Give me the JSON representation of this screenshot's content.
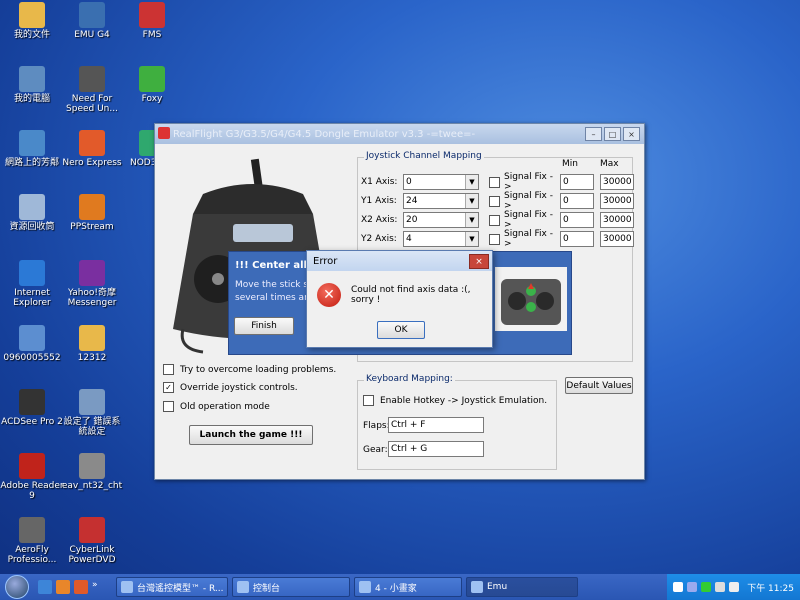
{
  "desktop_icons": [
    {
      "label": "我的文件",
      "icon": "folder-icon",
      "color": "#e8b84a"
    },
    {
      "label": "EMU G4",
      "icon": "app-shortcut-icon",
      "color": "#3a6fb0"
    },
    {
      "label": "FMS",
      "icon": "airplane-icon",
      "color": "#cc3333"
    },
    {
      "label": "我的電腦",
      "icon": "computer-icon",
      "color": "#5e8cc0"
    },
    {
      "label": "Need For Speed Un...",
      "icon": "game-icon",
      "color": "#555555"
    },
    {
      "label": "Foxy",
      "icon": "foxy-icon",
      "color": "#3faf3f"
    },
    {
      "label": "網路上的芳鄰",
      "icon": "network-icon",
      "color": "#4a89c9"
    },
    {
      "label": "Nero Express",
      "icon": "nero-icon",
      "color": "#e25a2a"
    },
    {
      "label": "NOD32-...",
      "icon": "nod32-icon",
      "color": "#2fa86e"
    },
    {
      "label": "資源回收筒",
      "icon": "recycle-bin-icon",
      "color": "#9fb8d8"
    },
    {
      "label": "PPStream",
      "icon": "ppstream-icon",
      "color": "#e07a1f"
    },
    {
      "label": "Internet Explorer",
      "icon": "ie-icon",
      "color": "#2b79d6"
    },
    {
      "label": "Yahoo!奇摩 Messenger",
      "icon": "yahoo-icon",
      "color": "#7a2fa0"
    },
    {
      "label": "0960005552",
      "icon": "shortcut-icon",
      "color": "#5c8ed0"
    },
    {
      "label": "12312",
      "icon": "folder-icon",
      "color": "#e8b84a"
    },
    {
      "label": "ACDSee Pro 2",
      "icon": "acdsee-icon",
      "color": "#333333"
    },
    {
      "label": "設定了 錯誤系統設定",
      "icon": "settings-icon",
      "color": "#7a9ac2"
    },
    {
      "label": "Adobe Reader 9",
      "icon": "adobe-reader-icon",
      "color": "#c0231b"
    },
    {
      "label": "eav_nt32_cht",
      "icon": "installer-icon",
      "color": "#8a8a8a"
    },
    {
      "label": "AeroFly Professio...",
      "icon": "aerofly-icon",
      "color": "#666666"
    },
    {
      "label": "CyberLink PowerDVD",
      "icon": "powerdvd-icon",
      "color": "#c53030"
    }
  ],
  "main_window": {
    "title": "RealFlight G3/G3.5/G4/G4.5 Dongle Emulator v3.3 -=twee=-",
    "controls": {
      "minimize": "–",
      "maximize": "□",
      "close": "×"
    },
    "joystick_group_title": "Joystick Channel Mapping",
    "col_min": "Min",
    "col_max": "Max",
    "signal_fix_label": "Signal Fix ->",
    "axes": [
      {
        "label": "X1 Axis:",
        "value": "0",
        "min": "0",
        "max": "30000"
      },
      {
        "label": "Y1 Axis:",
        "value": "24",
        "min": "0",
        "max": "30000"
      },
      {
        "label": "X2 Axis:",
        "value": "20",
        "min": "0",
        "max": "30000"
      },
      {
        "label": "Y2 Axis:",
        "value": "4",
        "min": "0",
        "max": "30000"
      }
    ],
    "options": [
      {
        "label": "Try to overcome loading problems.",
        "checked": false
      },
      {
        "label": "Override joystick controls.",
        "checked": true
      },
      {
        "label": "Old operation mode",
        "checked": false
      }
    ],
    "launch_button": "Launch the game !!!",
    "keyboard_group_title": "Keyboard Mapping:",
    "hotkey_label": "Enable Hotkey -> Joystick Emulation.",
    "flaps_label": "Flaps:",
    "flaps_value": "Ctrl + F",
    "gear_label": "Gear:",
    "gear_value": "Ctrl + G",
    "default_values_button": "Default Values"
  },
  "center_dialog": {
    "title": "!!! Center all the",
    "text_line1": "Move the stick sho",
    "text_line2": "several times and p",
    "finish_button": "Finish"
  },
  "error_dialog": {
    "title": "Error",
    "message": "Could not find axis data :(, sorry !",
    "ok_button": "OK",
    "close": "×"
  },
  "taskbar": {
    "tasks": [
      {
        "label": "台灣遙控模型™ - R...",
        "active": false
      },
      {
        "label": "控制台",
        "active": false
      },
      {
        "label": "4 - 小畫家",
        "active": false
      },
      {
        "label": "Emu",
        "active": true
      }
    ],
    "time": "下午 11:25"
  }
}
